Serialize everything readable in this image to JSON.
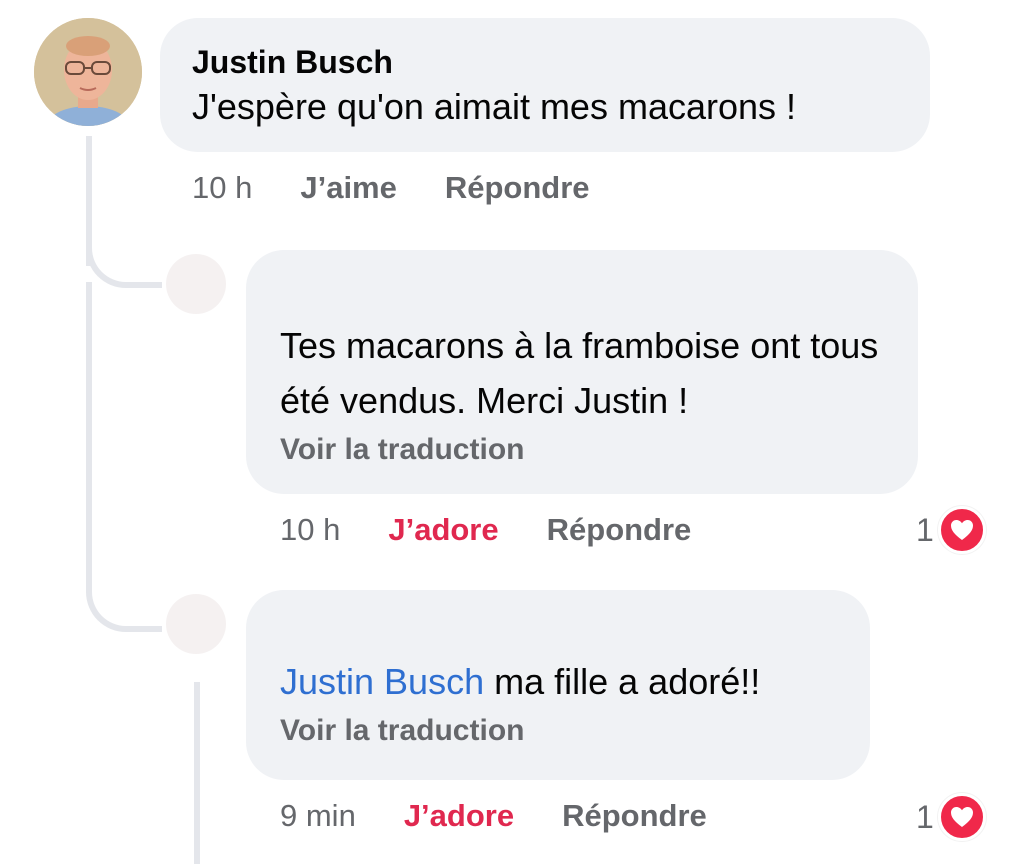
{
  "comments": [
    {
      "author": "Justin Busch",
      "text": "J'espère qu'on aimait mes macarons !",
      "time": "10 h",
      "like_label": "J’aime",
      "reply_label": "Répondre"
    }
  ],
  "replies": [
    {
      "author": "",
      "text": "Tes macarons à la framboise ont tous été vendus. Merci Justin !",
      "translate_label": "Voir la traduction",
      "time": "10 h",
      "reaction_label": "J’adore",
      "reply_label": "Répondre",
      "reaction_count": "1"
    },
    {
      "author": "",
      "mention": "Justin Busch",
      "text": " ma fille a adoré!!",
      "translate_label": "Voir la traduction",
      "time": "9 min",
      "reaction_label": "J’adore",
      "reply_label": "Répondre",
      "reaction_count": "1"
    }
  ],
  "colors": {
    "bubble_bg": "#f0f2f5",
    "love_red": "#e0284f",
    "mention_blue": "#2f6fd1",
    "meta_gray": "#65676b"
  },
  "icons": {
    "reaction": "heart-icon"
  }
}
